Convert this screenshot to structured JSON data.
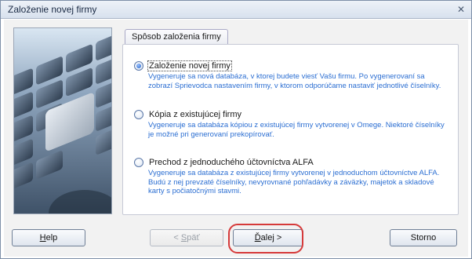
{
  "window": {
    "title": "Založenie novej firmy",
    "close_glyph": "✕"
  },
  "tab": {
    "label": "Spôsob založenia firmy"
  },
  "options": [
    {
      "label": "Založenie novej firmy",
      "checked": true,
      "description": "Vygeneruje sa nová databáza, v ktorej budete viesť Vašu firmu. Po vygenerovaní sa zobrazí Sprievodca nastavením firmy, v ktorom odporúčame nastaviť jednotlivé číselníky."
    },
    {
      "label": "Kópia z existujúcej firmy",
      "checked": false,
      "description": "Vygeneruje sa databáza kópiou z existujúcej firmy vytvorenej v Omege. Niektoré číselníky je možné pri generovaní prekopírovať."
    },
    {
      "label": "Prechod z jednoduchého účtovníctva ALFA",
      "checked": false,
      "description": "Vygeneruje sa databáza z existujúcej firmy vytvorenej v jednoduchom účtovníctve ALFA. Budú z nej prevzaté číselníky, nevyrovnané pohľadávky a záväzky, majetok a skladové karty s počiatočnými stavmi."
    }
  ],
  "buttons": {
    "help": {
      "pre": "",
      "mnemonic": "H",
      "post": "elp"
    },
    "back": {
      "pre": "< ",
      "mnemonic": "S",
      "post": "päť"
    },
    "next": {
      "pre": "",
      "mnemonic": "Ď",
      "post": "alej >"
    },
    "cancel": {
      "label": "Storno"
    }
  },
  "colors": {
    "description_text": "#2b6ed2",
    "highlight_ring": "#d63a3a"
  },
  "icons": {
    "close": "close-icon",
    "radio_checked": "radio-checked-icon",
    "radio_unchecked": "radio-unchecked-icon"
  }
}
